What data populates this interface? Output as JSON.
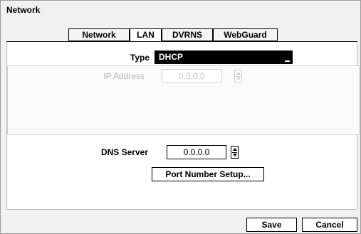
{
  "window": {
    "title": "Network"
  },
  "tabs": [
    {
      "label": "Network",
      "active": false
    },
    {
      "label": "LAN",
      "active": true
    },
    {
      "label": "DVRNS",
      "active": false
    },
    {
      "label": "WebGuard",
      "active": false
    }
  ],
  "lan": {
    "type_label": "Type",
    "type_value": "DHCP",
    "ip_address_label": "IP Address",
    "ip_address_value": "0.0.0.0",
    "ip_address_disabled": true,
    "dns_server_label": "DNS Server",
    "dns_server_value": "0.0.0.0",
    "port_button_label": "Port Number Setup..."
  },
  "footer": {
    "save_label": "Save",
    "cancel_label": "Cancel"
  },
  "colors": {
    "window_bg": "#f1f1f1",
    "panel_bg": "#ffffff",
    "select_bg": "#000000",
    "disabled_text": "#b8b8b8"
  }
}
